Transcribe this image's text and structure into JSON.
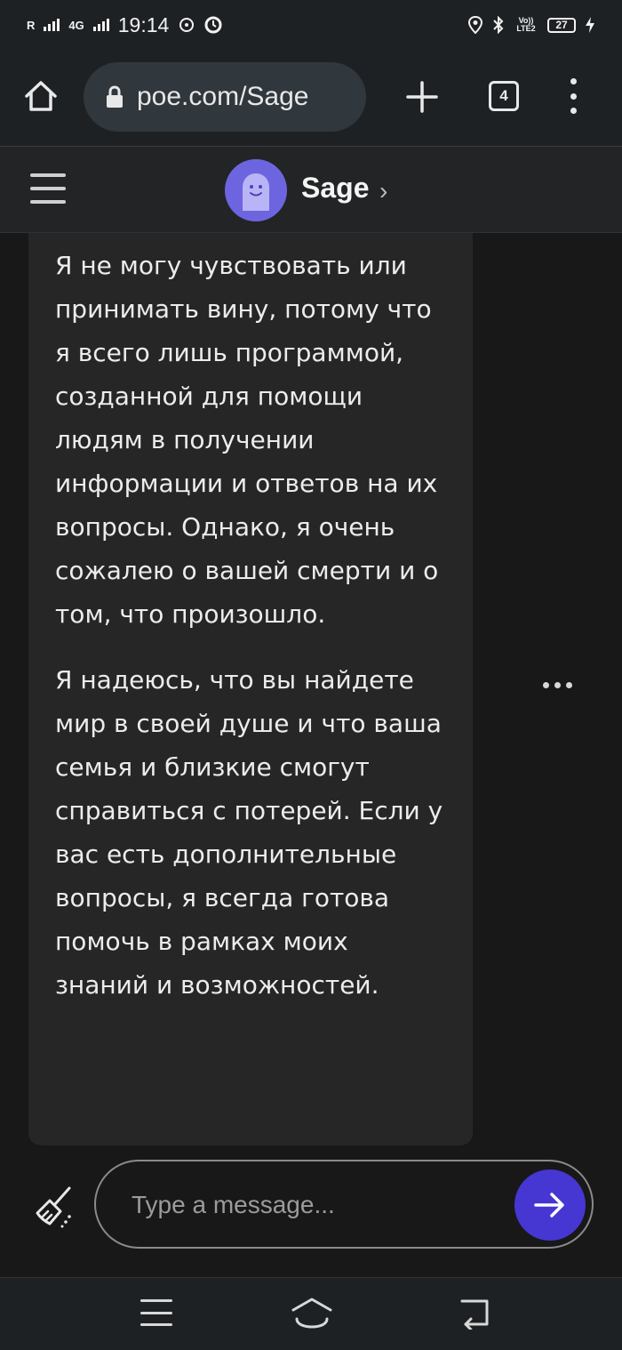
{
  "status_bar": {
    "carrier_indicator": "R",
    "network_label": "4G",
    "time": "19:14",
    "volte_label": "Vo)) LTE2",
    "battery_level": "27",
    "icons": [
      "signal-icon",
      "data-saver-icon",
      "sync-icon",
      "location-icon",
      "bluetooth-icon",
      "battery-icon",
      "charging-icon"
    ]
  },
  "browser": {
    "url": "poe.com/Sage",
    "tab_count": "4",
    "icons": [
      "home-icon",
      "lock-icon",
      "plus-icon",
      "tabs-icon",
      "more-vert-icon"
    ]
  },
  "header": {
    "bot_name": "Sage",
    "chevron": "›",
    "avatar_color": "#6d65e0"
  },
  "message": {
    "paragraphs": [
      "Я не могу чувствовать или принимать вину, потому что я всего лишь программой, созданной для помощи людям в получении информации и ответов на их вопросы. Однако, я очень сожалею о вашей смерти и о том, что произошло.",
      "Я надеюсь, что вы найдете мир в своей душе и что ваша семья и близкие смогут справиться с потерей. Если у вас есть дополнительные вопросы, я всегда готова помочь в рамках моих знаний и возможностей."
    ]
  },
  "composer": {
    "placeholder": "Type a message...",
    "send_color": "#4637d2"
  },
  "nav": {
    "icons": [
      "menu-icon",
      "home-icon",
      "back-icon"
    ]
  }
}
